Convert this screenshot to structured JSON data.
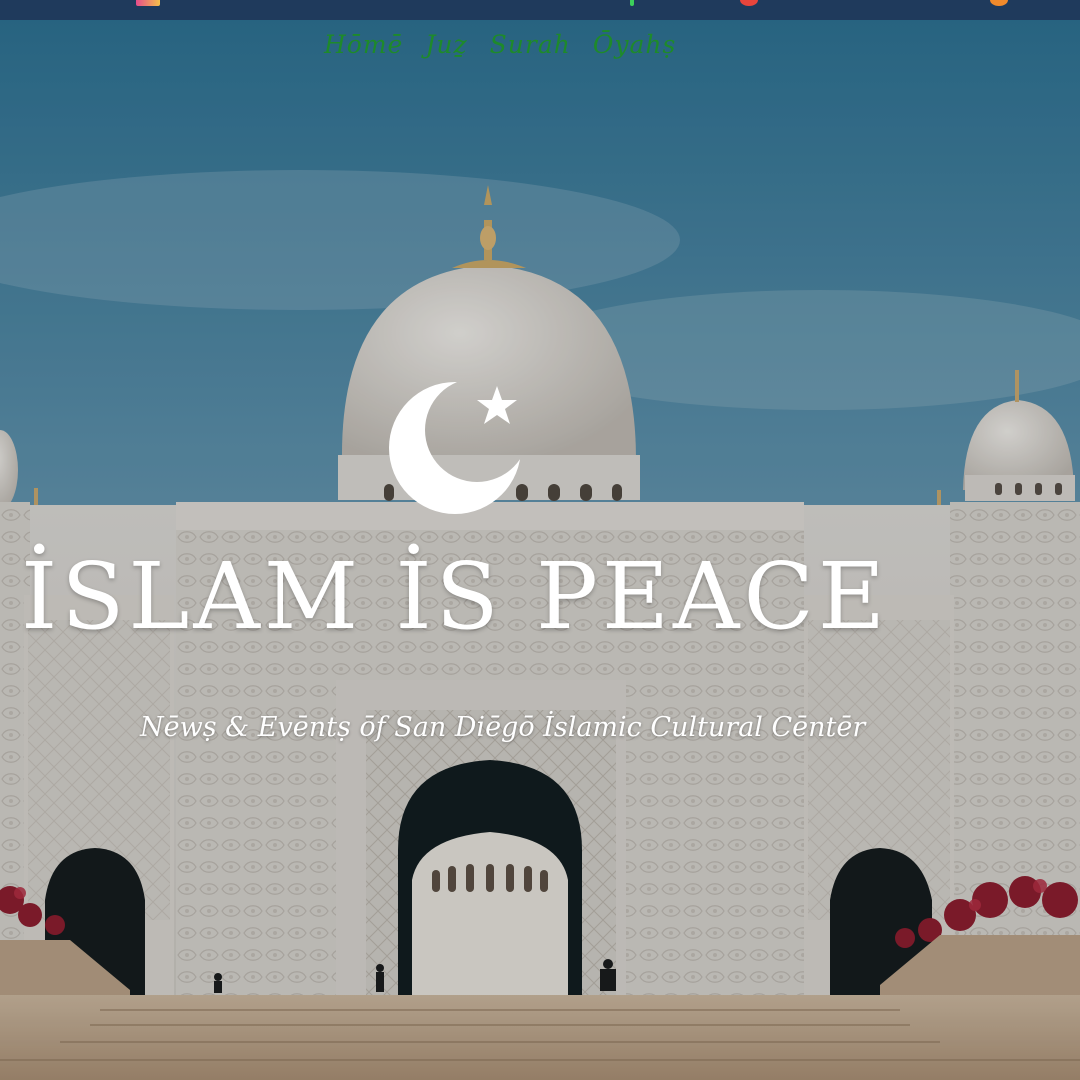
{
  "nav": {
    "items": [
      {
        "label": "Hōmē"
      },
      {
        "label": "Juẕ"
      },
      {
        "label": "Surah"
      },
      {
        "label": "Ōyahṣ"
      }
    ]
  },
  "hero": {
    "title": "İSLAM İS PEACE",
    "subtitle": "Nēwṣ & Evēntṣ ōf San Diēgō İslamic Cultural Cēntēr",
    "emblem_icon": "crescent-star-icon"
  },
  "colors": {
    "topbar": "#1f3a5c",
    "nav_text": "#1e8a2a",
    "hero_text": "#ffffff",
    "sky": "#5f8ea6"
  }
}
